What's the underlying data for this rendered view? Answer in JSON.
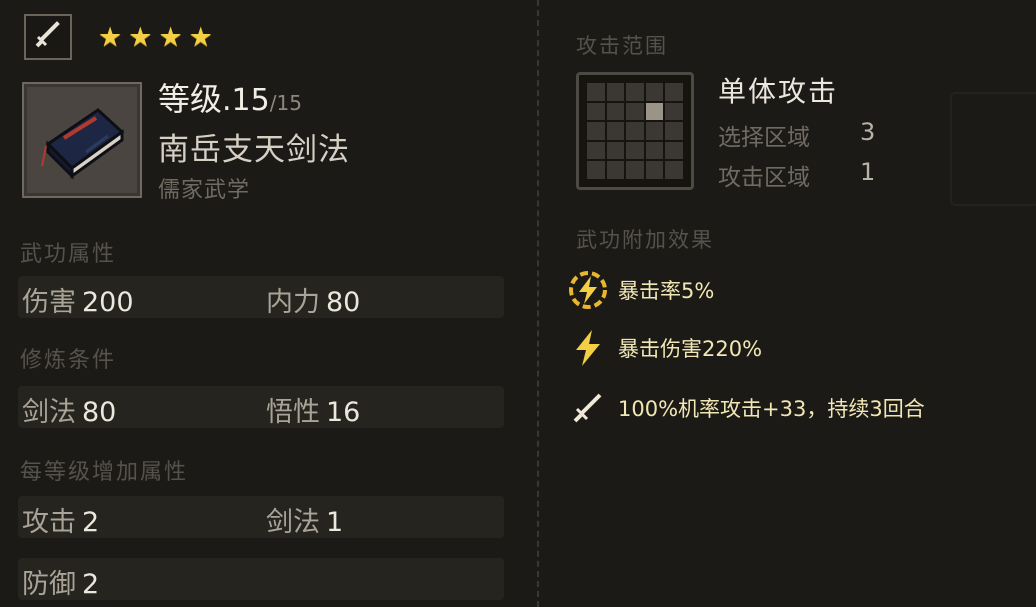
{
  "header": {
    "stars": [
      "★",
      "★",
      "★",
      "★"
    ],
    "type_icon": "sword-icon"
  },
  "skill": {
    "level_label": "等级",
    "level_current": ".15",
    "level_max": "/15",
    "name": "南岳支天剑法",
    "school": "儒家武学",
    "book_icon": "book-icon"
  },
  "attributes": {
    "section": "武功属性",
    "damage_label": "伤害",
    "damage_value": "200",
    "inner_label": "内力",
    "inner_value": "80"
  },
  "requirements": {
    "section": "修炼条件",
    "sword_label": "剑法",
    "sword_value": "80",
    "wisdom_label": "悟性",
    "wisdom_value": "16"
  },
  "per_level": {
    "section": "每等级增加属性",
    "attack_label": "攻击",
    "attack_value": "2",
    "sword_label": "剑法",
    "sword_value": "1",
    "defense_label": "防御",
    "defense_value": "2"
  },
  "range": {
    "section": "攻击范围",
    "type": "单体攻击",
    "select_label": "选择区域",
    "select_value": "3",
    "attack_label": "攻击区域",
    "attack_value": "1"
  },
  "effects": {
    "section": "武功附加效果",
    "items": [
      {
        "icon": "lightning-circle-icon",
        "text": "暴击率5%"
      },
      {
        "icon": "lightning-icon",
        "text": "暴击伤害220%"
      },
      {
        "icon": "sword-icon",
        "text": "100%机率攻击+33，持续3回合"
      }
    ]
  },
  "colors": {
    "accent_gold": "#f3cf45",
    "effect_text": "#f1e7b5",
    "background": "#1c1a17"
  }
}
